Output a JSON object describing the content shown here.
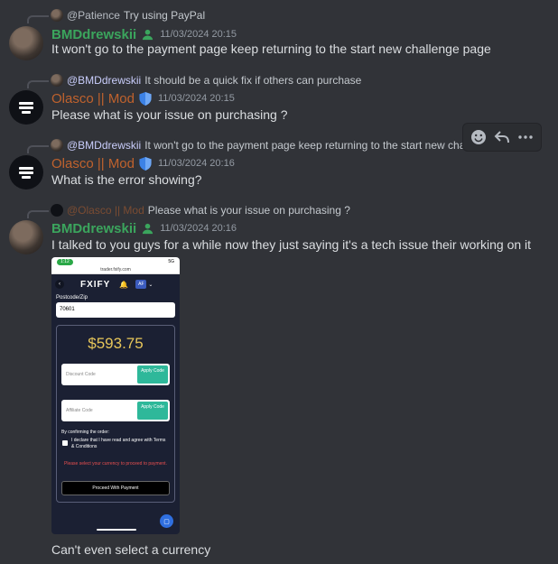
{
  "messages": [
    {
      "reply_to": {
        "name": "@Patience",
        "text": "Try using PayPal"
      },
      "author": "BMDdrewskii",
      "timestamp": "11/03/2024 20:15",
      "text": "It won't go to the payment page keep returning to the start new challenge page"
    },
    {
      "reply_to": {
        "name": "@BMDdrewskii",
        "text": "It should be a quick fix if others can purchase"
      },
      "author": "Olasco || Mod",
      "timestamp": "11/03/2024 20:15",
      "text": "Please what is your issue on purchasing ?"
    },
    {
      "reply_to": {
        "name": "@BMDdrewskii",
        "text": "It won't go to the payment page keep returning to the start new challenge page"
      },
      "author": "Olasco || Mod",
      "timestamp": "11/03/2024 20:16",
      "text": "What is the error showing?"
    },
    {
      "reply_to": {
        "name": "@Olasco || Mod",
        "text": "Please what is your issue on purchasing ?"
      },
      "author": "BMDdrewskii",
      "timestamp": "11/03/2024 20:16",
      "text": "I talked to you guys for a while now they just saying it's a tech issue their working on it",
      "followup_text": "Can't even select a currency"
    }
  ],
  "toolbar": {
    "emoji_icon": "smile-icon",
    "reply_icon": "reply-icon",
    "more_icon": "more-icon"
  },
  "attachment": {
    "status_pill": "1:12",
    "signal": "5G",
    "url": "trader.fxify.com",
    "logo": "FXIFY",
    "avatar_initials": "AF",
    "postcode_label": "Postcode/Zip",
    "postcode_value": "70601",
    "price": "$593.75",
    "discount_placeholder": "Discount Code",
    "affiliate_placeholder": "Affiliate Code",
    "apply_label": "Apply Code",
    "confirm_heading": "By confirming the order:",
    "declare_text": "I declare that I have read and agree with Terms & Conditions",
    "error_text": "Please select your currency to proceed to payment.",
    "proceed_label": "Proceed With Payment"
  },
  "colors": {
    "green_name": "#3ba55d",
    "mod_name": "#c0622d",
    "background": "#313338"
  }
}
